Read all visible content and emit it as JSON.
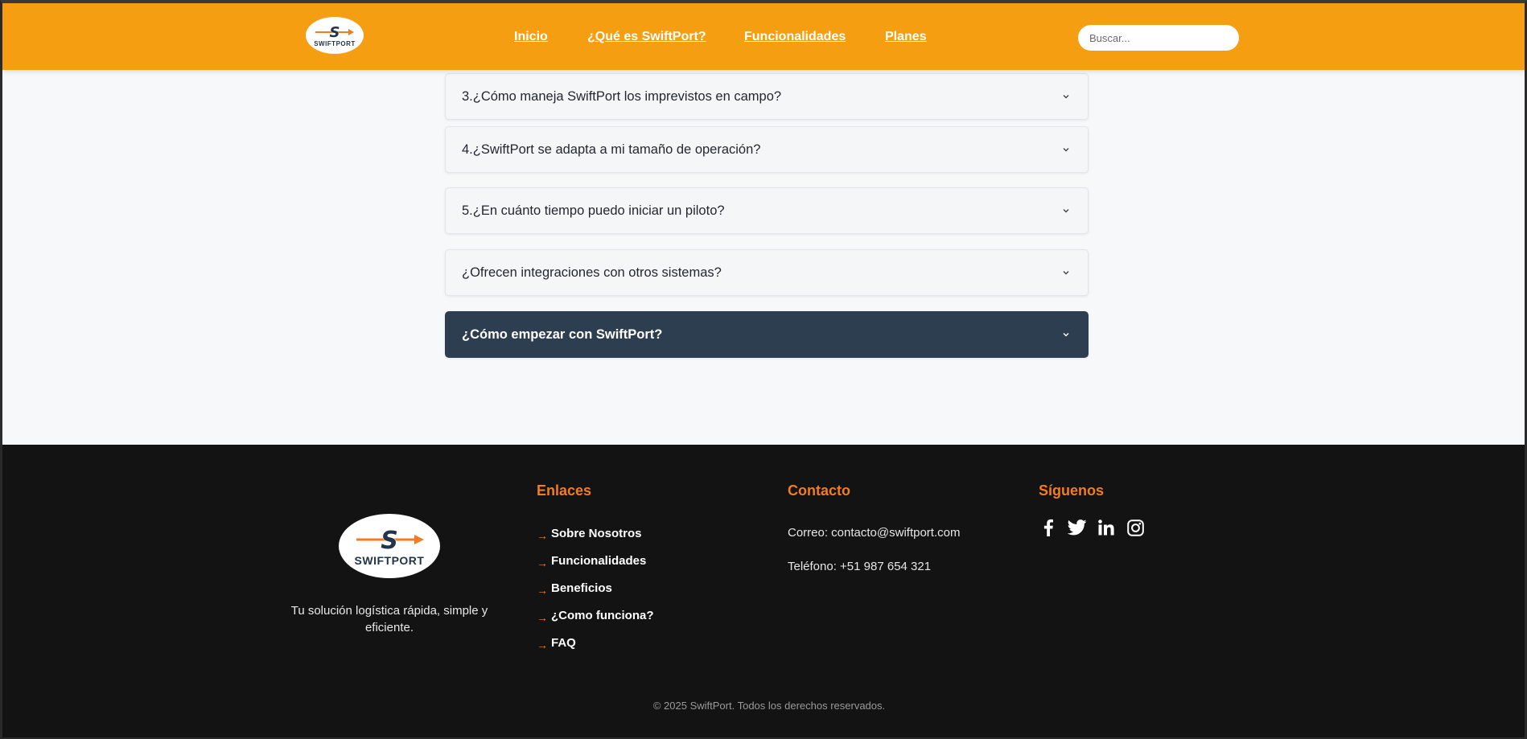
{
  "header": {
    "logo_text": "SWIFTPORT",
    "nav": [
      "Inicio",
      "¿Qué es SwiftPort?",
      "Funcionalidades",
      "Planes"
    ],
    "search_placeholder": "Buscar..."
  },
  "faq": [
    {
      "question": "3.¿Cómo maneja SwiftPort los imprevistos en campo?",
      "active": false
    },
    {
      "question": "4.¿SwiftPort se adapta a mi tamaño de operación?",
      "active": false
    },
    {
      "question": "5.¿En cuánto tiempo puedo iniciar un piloto?",
      "active": false
    },
    {
      "question": "¿Ofrecen integraciones con otros sistemas?",
      "active": false
    },
    {
      "question": "¿Cómo empezar con SwiftPort?",
      "active": true
    }
  ],
  "footer": {
    "logo_text": "SWIFTPORT",
    "tagline": "Tu solución logística rápida, simple y eficiente.",
    "links_title": "Enlaces",
    "links": [
      "Sobre Nosotros",
      "Funcionalidades",
      "Beneficios",
      "¿Como funciona?",
      "FAQ"
    ],
    "link_arrow": "→",
    "contact_title": "Contacto",
    "email_line": "Correo: contacto@swiftport.com",
    "phone_line": "Teléfono: +51 987 654 321",
    "social_title": "Síguenos",
    "social_icons": [
      "facebook-icon",
      "twitter-icon",
      "linkedin-icon",
      "instagram-icon"
    ],
    "copyright": "© 2025 SwiftPort. Todos los derechos reservados."
  },
  "colors": {
    "header_bg": "#f59e12",
    "footer_bg": "#131313",
    "accent_orange": "#f47c20",
    "navy": "#2d3e50"
  }
}
